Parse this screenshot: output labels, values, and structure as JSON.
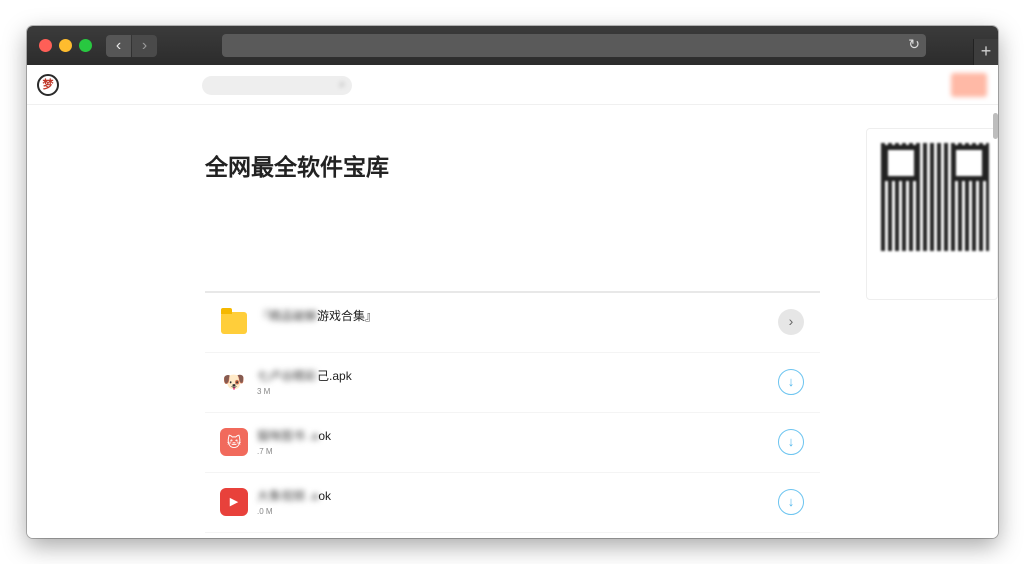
{
  "browser": {
    "nav_back": "‹",
    "nav_forward": "›",
    "reload_icon": "↻",
    "new_tab": "+"
  },
  "site": {
    "logo_char": "梦",
    "name": "",
    "slogan": "",
    "search_placeholder": "",
    "search_icon": "⌕",
    "login_label": ""
  },
  "main": {
    "heading": "全网最全软件宝库",
    "description": ""
  },
  "list": {
    "items": [
      {
        "type": "folder",
        "title_visible": "游戏合集』",
        "title_blurred": "『精品破解",
        "description": "",
        "action_icon": "›"
      },
      {
        "type": "apk",
        "title_visible": "己.apk",
        "title_blurred": "七卢谷精彩",
        "size_visible": "3 M",
        "size_blurred": "",
        "action_icon": "↓"
      },
      {
        "type": "apk",
        "title_visible": "ok",
        "title_blurred": "猫咪图书 .a",
        "size_visible": ".7 M",
        "size_blurred": "",
        "action_icon": "↓"
      },
      {
        "type": "apk",
        "title_visible": "ok",
        "title_blurred": "大象视频 .a",
        "size_visible": ".0 M",
        "size_blurred": "",
        "action_icon": "↓"
      }
    ]
  },
  "sidebar": {
    "qr_caption": ""
  },
  "colors": {
    "brand": "#ff5a3c",
    "download_accent": "#4fb6ec",
    "folder": "#ffce3a"
  }
}
